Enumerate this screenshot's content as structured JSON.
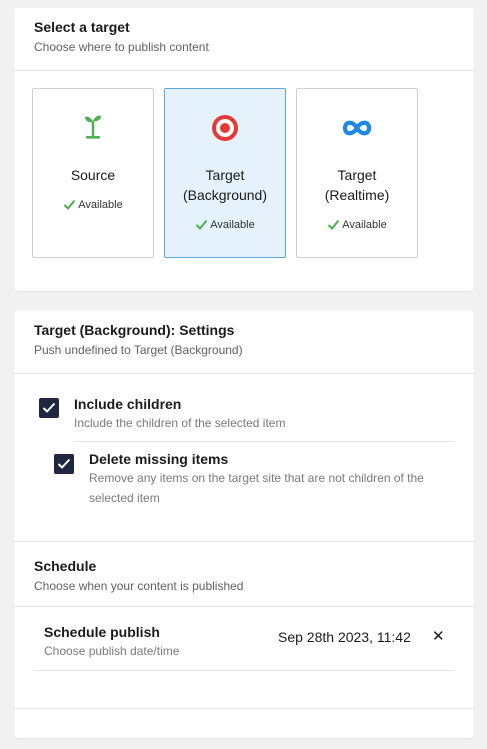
{
  "select_target": {
    "title": "Select a target",
    "subtitle": "Choose where to publish content",
    "targets": [
      {
        "name": "Source",
        "status": "Available",
        "icon": "sprout-icon",
        "selected": false
      },
      {
        "name": "Target (Background)",
        "name_line1": "Target",
        "name_line2": "(Background)",
        "status": "Available",
        "icon": "target-icon",
        "selected": true
      },
      {
        "name": "Target (Realtime)",
        "name_line1": "Target",
        "name_line2": "(Realtime)",
        "status": "Available",
        "icon": "infinity-icon",
        "selected": false
      }
    ]
  },
  "settings": {
    "title": "Target (Background): Settings",
    "subtitle": "Push undefined to Target (Background)",
    "options": [
      {
        "label": "Include children",
        "description": "Include the children of the selected item",
        "checked": true
      },
      {
        "label": "Delete missing items",
        "description_line1": "Remove any items on the target site that are not children of the",
        "description_line2": "selected item",
        "checked": true
      }
    ]
  },
  "schedule": {
    "title": "Schedule",
    "subtitle": "Choose when your content is published",
    "label": "Schedule publish",
    "description": "Choose publish date/time",
    "value": "Sep 28th 2023, 11:42",
    "clear_symbol": "✕"
  },
  "colors": {
    "accent_green": "#4caf50",
    "target_red": "#e53935",
    "infinity_blue": "#1e88e5",
    "checkbox_navy": "#1e2640",
    "selected_bg": "#e5f1fb"
  }
}
